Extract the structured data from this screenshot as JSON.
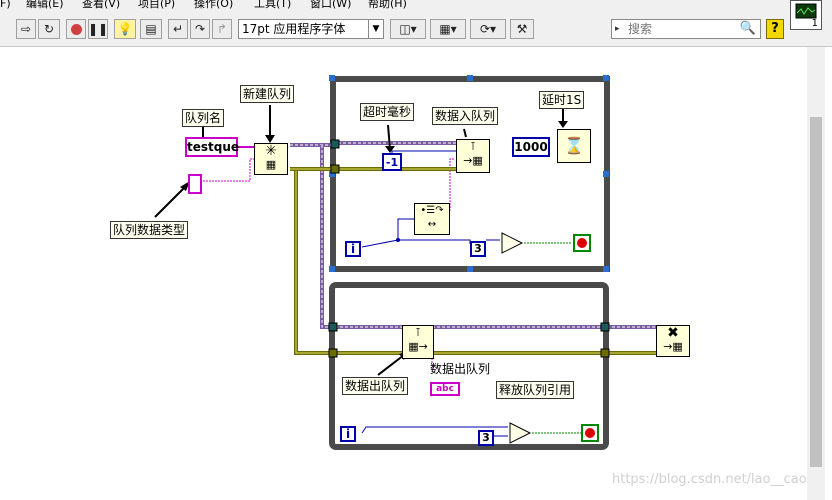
{
  "menu": [
    "F)",
    "编辑(E)",
    "查看(V)",
    "项目(P)",
    "操作(O)",
    "工具(T)",
    "窗口(W)",
    "帮助(H)"
  ],
  "toolbar": {
    "font": "17pt 应用程序字体",
    "search_placeholder": "搜索",
    "help_label": "?"
  },
  "vi_icon": {
    "number": "1"
  },
  "diagram": {
    "labels": {
      "queue_name": "队列名",
      "new_queue": "新建队列",
      "queue_data_type": "队列数据类型",
      "timeout_ms": "超时毫秒",
      "enqueue": "数据入队列",
      "delay": "延时1S",
      "dequeue": "数据出队列",
      "dequeue_indicator": "数据出队列",
      "release_queue": "释放队列引用"
    },
    "constants": {
      "queue_name_value": "testque",
      "timeout_value": "-1",
      "delay_value": "1000",
      "loop1_compare": "3",
      "loop2_compare": "3",
      "iter_1": "i",
      "iter_2": "i",
      "indicator_value": "abc"
    },
    "colors": {
      "string_wire": "#cc00cc",
      "refnum_wire": "#7a5c9e",
      "error_wire": "#6b6b00",
      "numeric_int": "#0000aa",
      "loop_frame": "#4a4a4a",
      "selected_handle": "#2a6fd0"
    }
  },
  "watermark": "https://blog.csdn.net/lao__cao"
}
